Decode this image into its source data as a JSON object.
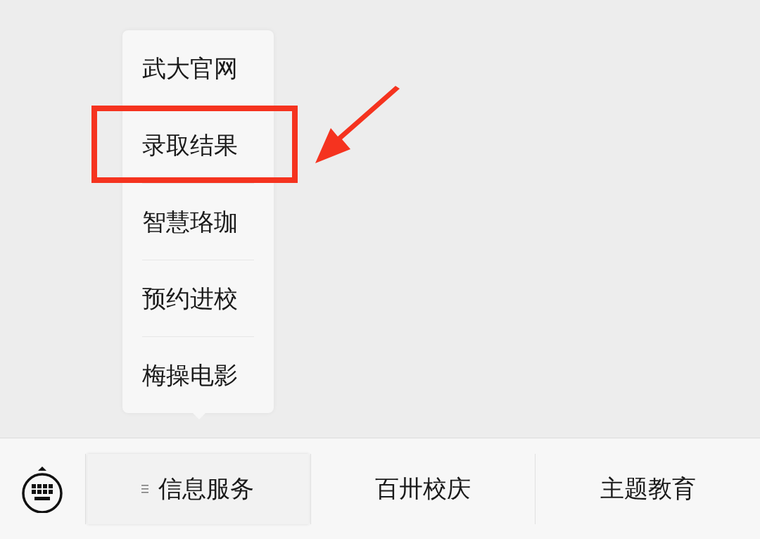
{
  "popup_menu": {
    "items": [
      {
        "label": "武大官网",
        "highlighted": false
      },
      {
        "label": "录取结果",
        "highlighted": true
      },
      {
        "label": "智慧珞珈",
        "highlighted": false
      },
      {
        "label": "预约进校",
        "highlighted": false
      },
      {
        "label": "梅操电影",
        "highlighted": false
      }
    ]
  },
  "bottom_bar": {
    "menus": [
      {
        "label": "信息服务",
        "selected": true,
        "has_submenu": true
      },
      {
        "label": "百卅校庆",
        "selected": false,
        "has_submenu": false
      },
      {
        "label": "主题教育",
        "selected": false,
        "has_submenu": false
      }
    ]
  }
}
